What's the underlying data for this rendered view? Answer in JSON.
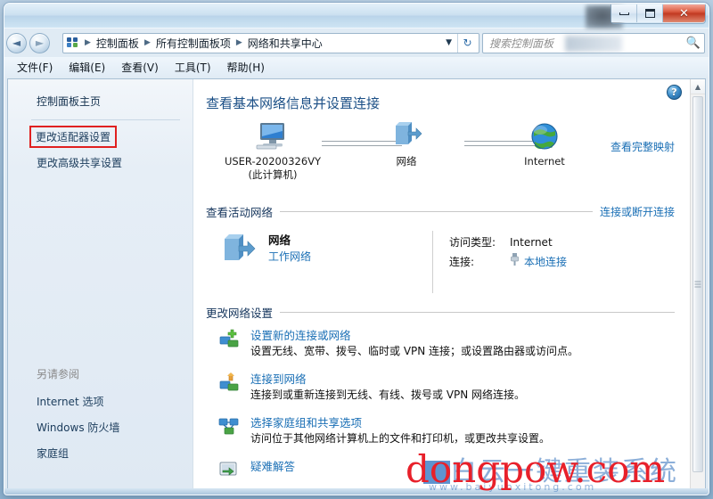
{
  "window": {
    "controls": {
      "minimize": "–",
      "maximize": "□",
      "close": "✕"
    }
  },
  "addressbar": {
    "back_icon": "◄",
    "forward_icon": "►",
    "crumbs": [
      "控制面板",
      "所有控制面板项",
      "网络和共享中心"
    ],
    "separator": "▶",
    "dropdown_icon": "▼",
    "refresh_icon": "↻",
    "search_placeholder": "搜索控制面板",
    "search_value": "",
    "search_icon": "🔍"
  },
  "menubar": {
    "items": [
      "文件(F)",
      "编辑(E)",
      "查看(V)",
      "工具(T)",
      "帮助(H)"
    ]
  },
  "sidebar": {
    "home": "控制面板主页",
    "links": [
      "更改适配器设置",
      "更改高级共享设置"
    ],
    "highlighted_index": 0,
    "highlight_color": "#e02020",
    "see_also_title": "另请参阅",
    "see_also": [
      "Internet 选项",
      "Windows 防火墙",
      "家庭组"
    ]
  },
  "content": {
    "help_icon": "?",
    "page_title": "查看基本网络信息并设置连接",
    "netmap": {
      "nodes": [
        {
          "icon": "computer-monitor-icon",
          "label_line1": "USER-20200326VY",
          "label_line2": "(此计算机)"
        },
        {
          "icon": "network-server-icon",
          "label_line1": "网络",
          "label_line2": ""
        },
        {
          "icon": "internet-globe-icon",
          "label_line1": "Internet",
          "label_line2": ""
        }
      ],
      "full_map_link": "查看完整映射"
    },
    "active_networks": {
      "heading": "查看活动网络",
      "action": "连接或断开连接",
      "network_name": "网络",
      "network_type": "工作网络",
      "rows": [
        {
          "key": "访问类型:",
          "value": "Internet",
          "is_link": false
        },
        {
          "key": "连接:",
          "value": "本地连接",
          "is_link": true
        }
      ]
    },
    "change_settings": {
      "heading": "更改网络设置",
      "items": [
        {
          "icon": "new-connection-icon",
          "title": "设置新的连接或网络",
          "desc": "设置无线、宽带、拨号、临时或 VPN 连接；或设置路由器或访问点。"
        },
        {
          "icon": "connect-network-icon",
          "title": "连接到网络",
          "desc": "连接到或重新连接到无线、有线、拨号或 VPN 网络连接。"
        },
        {
          "icon": "homegroup-sharing-icon",
          "title": "选择家庭组和共享选项",
          "desc": "访问位于其他网络计算机上的文件和打印机，或更改共享设置。"
        },
        {
          "icon": "troubleshoot-icon",
          "title": "疑难解答",
          "desc": ""
        }
      ]
    }
  },
  "scrollbar": {
    "up_arrow": "▲",
    "down_arrow": "▼"
  },
  "watermark": {
    "red_text": "dongpow.com",
    "blue_text": "白云一键重装系统",
    "blue_url": "www.baiyunxitong.com"
  }
}
